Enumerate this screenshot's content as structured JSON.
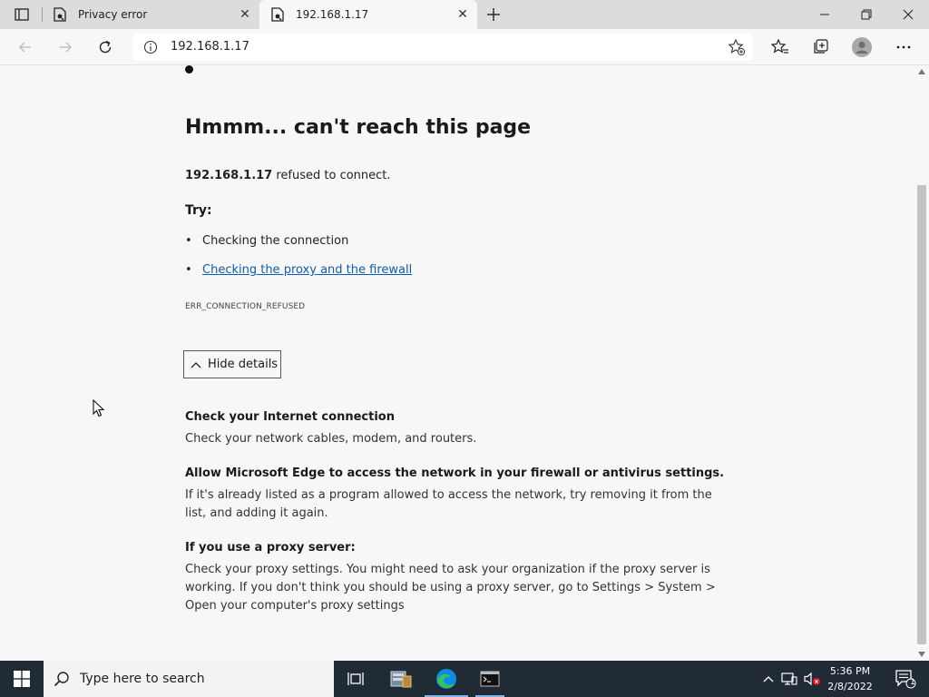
{
  "browser": {
    "tabs": [
      {
        "label": "Privacy error",
        "active": false
      },
      {
        "label": "192.168.1.17",
        "active": true
      }
    ],
    "address": {
      "url": "192.168.1.17"
    }
  },
  "page": {
    "title": "Hmmm... can't reach this page",
    "host": "192.168.1.17",
    "refused_suffix": " refused to connect.",
    "try_label": "Try:",
    "suggestions": [
      {
        "text": "Checking the connection",
        "link": false
      },
      {
        "text": "Checking the proxy and the firewall",
        "link": true
      }
    ],
    "error_code": "ERR_CONNECTION_REFUSED",
    "hide_details_label": "Hide details",
    "details": [
      {
        "heading": "Check your Internet connection",
        "body": "Check your network cables, modem, and routers."
      },
      {
        "heading": "Allow Microsoft Edge to access the network in your firewall or antivirus settings.",
        "body": "If it's already listed as a program allowed to access the network, try removing it from the list, and adding it again."
      },
      {
        "heading": "If you use a proxy server:",
        "body": "Check your proxy settings. You might need to ask your organization if the proxy server is working. If you don't think you should be using a proxy server, go to Settings > System > Open your computer's proxy settings"
      }
    ]
  },
  "taskbar": {
    "search_placeholder": "Type here to search",
    "time": "5:36 PM",
    "date": "2/8/2022",
    "notification_count": "1"
  },
  "colors": {
    "link": "#0f5da8",
    "taskbar_bg": "#202b36",
    "edge_blue": "#0c8ce9",
    "edge_green": "#37c35a"
  }
}
